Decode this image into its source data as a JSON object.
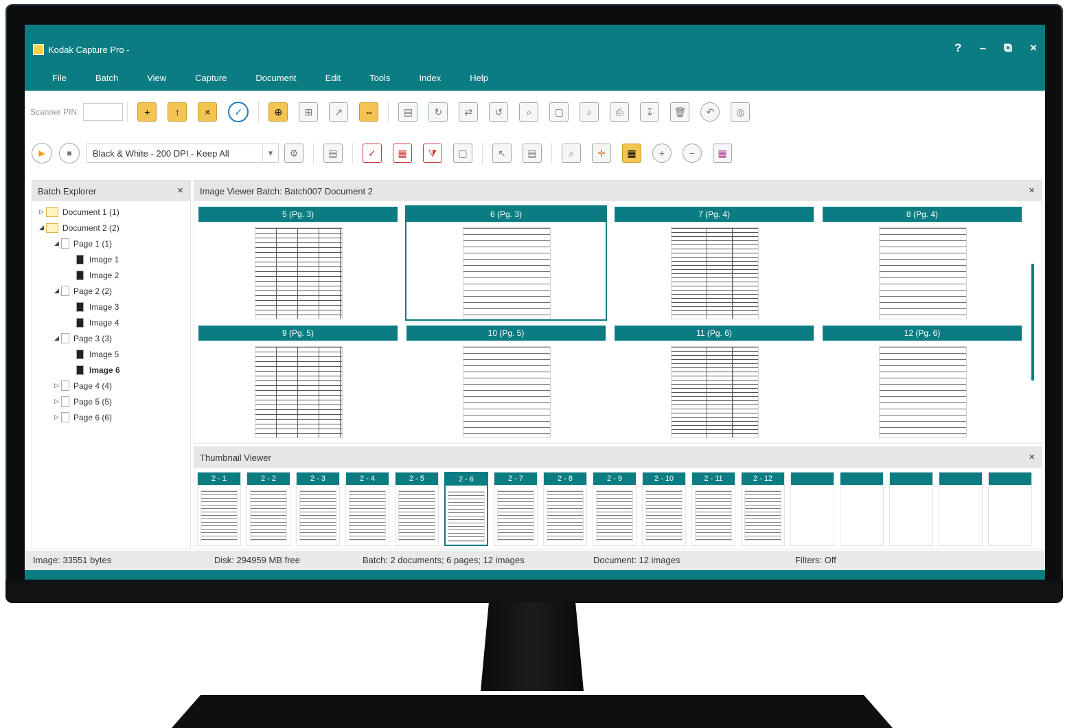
{
  "window": {
    "title": "Kodak Capture Pro -"
  },
  "window_controls": {
    "help": "?",
    "minimize": "–",
    "restore": "⧉",
    "close": "×"
  },
  "menu": [
    "File",
    "Batch",
    "View",
    "Capture",
    "Document",
    "Edit",
    "Tools",
    "Index",
    "Help"
  ],
  "toolbar1": {
    "scanner_pin_label": "Scanner PIN:"
  },
  "toolbar2": {
    "job_setup_value": "Black & White - 200 DPI - Keep All"
  },
  "batch_explorer": {
    "title": "Batch Explorer",
    "tree": [
      {
        "label": "Document 1 (1)",
        "kind": "document",
        "level": 0
      },
      {
        "label": "Document 2 (2)",
        "kind": "document",
        "level": 0,
        "expanded": true
      },
      {
        "label": "Page 1 (1)",
        "kind": "page",
        "level": 1,
        "expanded": true
      },
      {
        "label": "Image 1",
        "kind": "image",
        "level": 2
      },
      {
        "label": "Image 2",
        "kind": "image",
        "level": 2
      },
      {
        "label": "Page 2 (2)",
        "kind": "page",
        "level": 1,
        "expanded": true
      },
      {
        "label": "Image 3",
        "kind": "image",
        "level": 2
      },
      {
        "label": "Image 4",
        "kind": "image",
        "level": 2
      },
      {
        "label": "Page 3 (3)",
        "kind": "page",
        "level": 1,
        "expanded": true
      },
      {
        "label": "Image 5",
        "kind": "image",
        "level": 2
      },
      {
        "label": "Image 6",
        "kind": "image",
        "level": 2,
        "selected": true
      },
      {
        "label": "Page 4 (4)",
        "kind": "page",
        "level": 1
      },
      {
        "label": "Page 5 (5)",
        "kind": "page",
        "level": 1
      },
      {
        "label": "Page 6 (6)",
        "kind": "page",
        "level": 1
      }
    ]
  },
  "image_viewer": {
    "title": "Image Viewer   Batch: Batch007   Document 2",
    "pages": [
      {
        "label": "5 (Pg. 3)"
      },
      {
        "label": "6 (Pg. 3)",
        "selected": true
      },
      {
        "label": "7 (Pg. 4)"
      },
      {
        "label": "8 (Pg. 4)"
      },
      {
        "label": "9 (Pg. 5)"
      },
      {
        "label": "10 (Pg. 5)"
      },
      {
        "label": "11 (Pg. 6)"
      },
      {
        "label": "12 (Pg. 6)"
      }
    ]
  },
  "thumbnail_viewer": {
    "title": "Thumbnail Viewer",
    "items": [
      "2 - 1",
      "2 - 2",
      "2 - 3",
      "2 - 4",
      "2 - 5",
      "2 - 6",
      "2 - 7",
      "2 - 8",
      "2 - 9",
      "2 - 10",
      "2 - 11",
      "2 - 12",
      "",
      "",
      "",
      "",
      ""
    ],
    "selected_index": 5
  },
  "status_bar": {
    "image": "Image: 33551 bytes",
    "disk": "Disk: 294959 MB free",
    "batch": "Batch: 2 documents; 6 pages; 12 images",
    "document": "Document: 12 images",
    "filters": "Filters: Off"
  },
  "colors": {
    "accent": "#0b7d82",
    "folder": "#f3c451",
    "check": "#1a7bc0"
  }
}
